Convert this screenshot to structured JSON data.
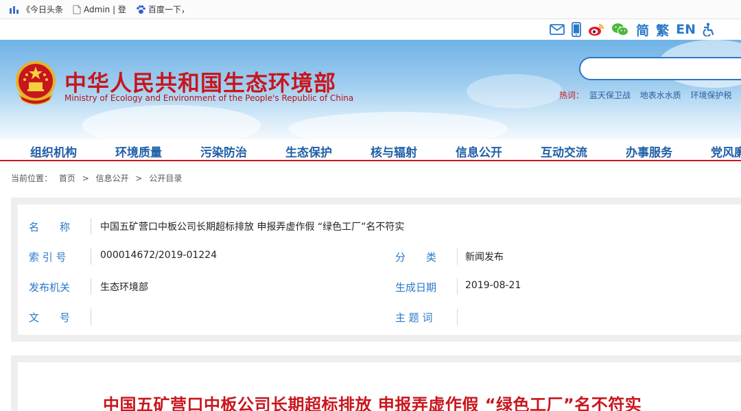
{
  "bookmarks": [
    {
      "icon": "bar-chart-icon",
      "label": "《今日头条"
    },
    {
      "icon": "document-icon",
      "label": "Admin | 登"
    },
    {
      "icon": "paw-icon",
      "label": "百度一下，"
    }
  ],
  "utility": {
    "icons": [
      "mail-icon",
      "mobile-icon",
      "weibo-icon",
      "wechat-icon"
    ],
    "simplified": "简",
    "traditional": "繁",
    "english": "EN",
    "accessibility_icon": "accessibility-icon"
  },
  "header": {
    "title_cn": "中华人民共和国生态环境部",
    "title_en": "Ministry of Ecology and Environment of the People's Republic of China",
    "search_placeholder": "",
    "hot_label": "热词：",
    "hot_words": [
      "蓝天保卫战",
      "地表水水质",
      "环境保护税"
    ]
  },
  "nav": [
    "组织机构",
    "环境质量",
    "污染防治",
    "生态保护",
    "核与辐射",
    "信息公开",
    "互动交流",
    "办事服务",
    "党风廉"
  ],
  "breadcrumb": {
    "label": "当前位置：",
    "items": [
      "首页",
      ">",
      "信息公开",
      ">",
      "公开目录"
    ]
  },
  "info": {
    "name_label": "名　　称",
    "name_value": "中国五矿营口中板公司长期超标排放 申报弄虚作假 “绿色工厂”名不符实",
    "index_label": "索 引 号",
    "index_value": "000014672/2019-01224",
    "category_label": "分　　类",
    "category_value": "新闻发布",
    "publisher_label": "发布机关",
    "publisher_value": "生态环境部",
    "date_label": "生成日期",
    "date_value": "2019-08-21",
    "doc_label": "文　　号",
    "doc_value": "",
    "topic_label": "主 题 词",
    "topic_value": ""
  },
  "article": {
    "title": "中国五矿营口中板公司长期超标排放 申报弄虚作假 “绿色工厂”名不符实"
  },
  "colors": {
    "brand_red": "#c8161d",
    "link_blue": "#2a78c8",
    "nav_blue": "#1f5fa8"
  }
}
